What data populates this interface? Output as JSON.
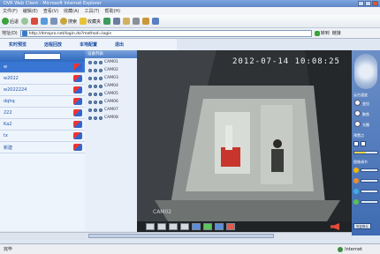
{
  "window": {
    "title": "DVR Web Client - Microsoft Internet Explorer"
  },
  "menubar": {
    "items": [
      "文件(F)",
      "编辑(E)",
      "查看(V)",
      "收藏(A)",
      "工具(T)",
      "帮助(H)"
    ]
  },
  "toolbar": {
    "back_label": "后退",
    "search_label": "搜索",
    "favorites_label": "收藏夹"
  },
  "address": {
    "label": "地址(D)",
    "url": "http://dmspro.net/login.do?method=login",
    "go_label": "转到",
    "links_label": "链接"
  },
  "nav": {
    "tabs": [
      "实时预览",
      "远程回放",
      "本地配置",
      "退出"
    ]
  },
  "devices": {
    "items": [
      {
        "name": "w",
        "selected": true
      },
      {
        "name": "w2022",
        "selected": false
      },
      {
        "name": "w2022224",
        "selected": false
      },
      {
        "name": "dqhq",
        "selected": false
      },
      {
        "name": "222",
        "selected": false
      },
      {
        "name": "Ka2",
        "selected": false
      },
      {
        "name": "tx",
        "selected": false
      },
      {
        "name": "新建",
        "selected": false
      }
    ]
  },
  "cameras": {
    "header": "设备列表",
    "items": [
      "CAM01",
      "CAM02",
      "CAM03",
      "CAM04",
      "CAM05",
      "CAM06",
      "CAM07",
      "CAM08"
    ]
  },
  "video": {
    "timestamp": "2012-07-14 10:08:25",
    "channel_label": "CAM02"
  },
  "ptz": {
    "speed_label": "云台速度",
    "preset_label": "预置点",
    "zoom_label": "变倍",
    "focus_label": "聚焦",
    "iris_label": "光圈",
    "image_label": "图像调节",
    "bottom_button": "恢复默认",
    "speed_level": 0.5
  },
  "status": {
    "left": "完毕",
    "zone": "Internet"
  },
  "colors": {
    "accent": "#3976d4",
    "video_bg": "#2b2e31",
    "panel": "#4e7fc7"
  }
}
